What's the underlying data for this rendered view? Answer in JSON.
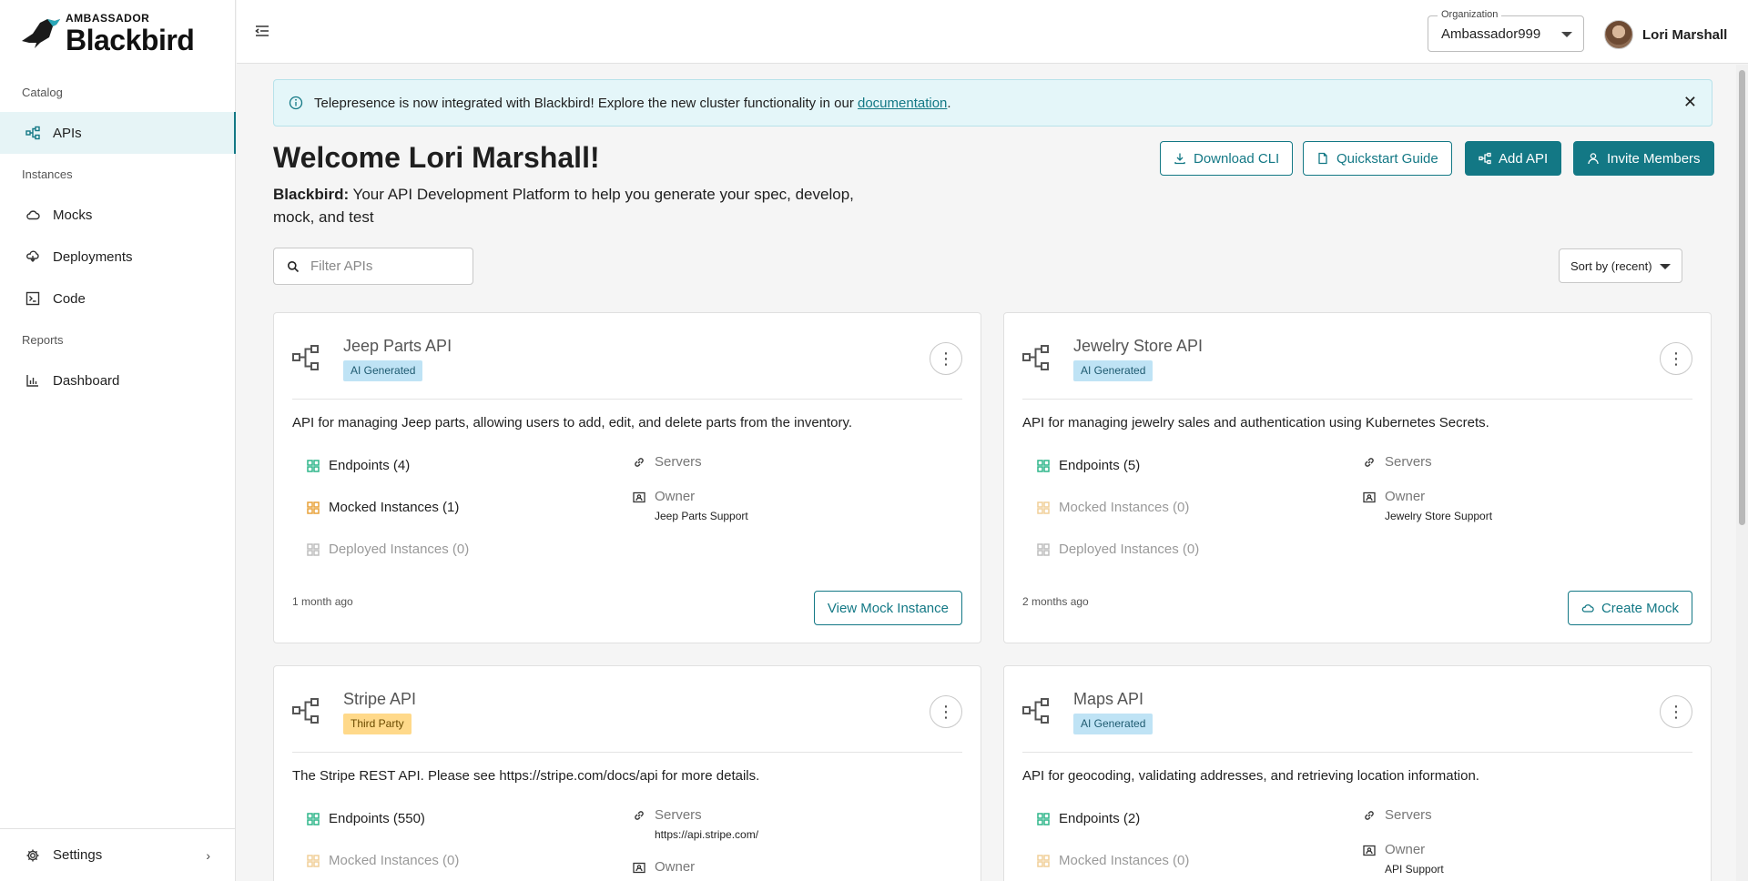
{
  "brand": {
    "small": "AMBASSADOR",
    "big": "Blackbird"
  },
  "sidebar": {
    "sections": [
      {
        "label": "Catalog"
      },
      {
        "label": "Instances"
      },
      {
        "label": "Reports"
      }
    ],
    "items": [
      {
        "label": "APIs",
        "icon": "api-icon",
        "active": true
      },
      {
        "label": "Mocks",
        "icon": "cloud-icon"
      },
      {
        "label": "Deployments",
        "icon": "deploy-icon"
      },
      {
        "label": "Code",
        "icon": "terminal-icon"
      },
      {
        "label": "Dashboard",
        "icon": "chart-icon"
      }
    ],
    "settings_label": "Settings"
  },
  "topbar": {
    "org_legend": "Organization",
    "org_value": "Ambassador999",
    "user_name": "Lori Marshall"
  },
  "banner": {
    "text": "Telepresence is now integrated with Blackbird! Explore the new cluster functionality in our ",
    "link": "documentation",
    "after": "."
  },
  "header": {
    "welcome": "Welcome Lori Marshall!",
    "subtitle_bold": "Blackbird:",
    "subtitle_rest": " Your API Development Platform to help you generate your spec, develop, mock, and test"
  },
  "actions": {
    "download_cli": "Download CLI",
    "quickstart": "Quickstart Guide",
    "add_api": "Add API",
    "invite": "Invite Members"
  },
  "filter": {
    "placeholder": "Filter APIs"
  },
  "sort": {
    "label": "Sort by (recent)"
  },
  "cards": [
    {
      "title": "Jeep Parts API",
      "tag": "AI Generated",
      "description": "API for managing Jeep parts, allowing users to add, edit, and delete parts from the inventory.",
      "endpoints": "Endpoints (4)",
      "mocked": "Mocked Instances (1)",
      "deployed": "Deployed Instances (0)",
      "servers_label": "Servers",
      "servers_value": "",
      "owner_label": "Owner",
      "owner_value": "Jeep Parts Support",
      "ago": "1 month ago",
      "button": "View Mock Instance"
    },
    {
      "title": "Jewelry Store API",
      "tag": "AI Generated",
      "description": "API for managing jewelry sales and authentication using Kubernetes Secrets.",
      "endpoints": "Endpoints (5)",
      "mocked": "Mocked Instances (0)",
      "deployed": "Deployed Instances (0)",
      "servers_label": "Servers",
      "servers_value": "",
      "owner_label": "Owner",
      "owner_value": "Jewelry Store Support",
      "ago": "2 months ago",
      "button": "Create Mock"
    },
    {
      "title": "Stripe API",
      "tag": "Third Party",
      "description": "The Stripe REST API. Please see https://stripe.com/docs/api for more details.",
      "endpoints": "Endpoints (550)",
      "mocked": "Mocked Instances (0)",
      "servers_label": "Servers",
      "servers_value": "https://api.stripe.com/",
      "owner_label": "Owner"
    },
    {
      "title": "Maps API",
      "tag": "AI Generated",
      "description": "API for geocoding, validating addresses, and retrieving location information.",
      "endpoints": "Endpoints (2)",
      "mocked": "Mocked Instances (0)",
      "servers_label": "Servers",
      "owner_label": "Owner",
      "owner_value": "API Support"
    }
  ],
  "colors": {
    "accent": "#137885",
    "ai_tag": "#bfe3f5",
    "third_party_tag": "#ffd98a",
    "banner_bg": "#e4f6f9"
  }
}
